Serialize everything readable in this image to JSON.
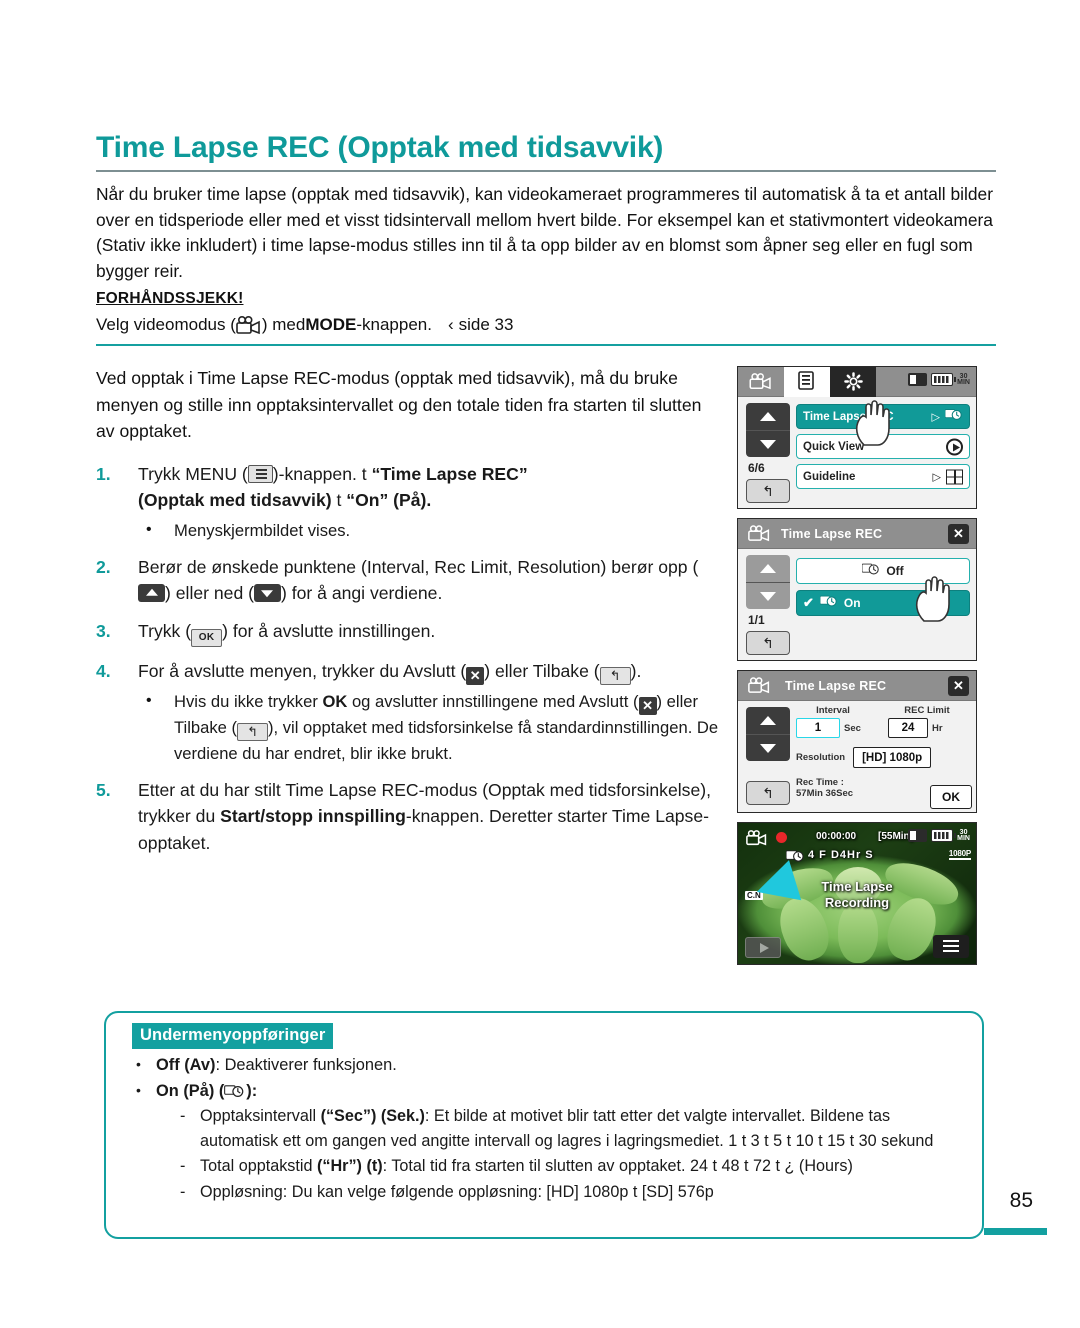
{
  "page": {
    "number": "85",
    "title": "Time Lapse REC (Opptak med tidsavvik)"
  },
  "intro": "Når du bruker time lapse (opptak med tidsavvik), kan videokameraet programmeres til automatisk å ta et antall bilder over en tidsperiode eller med et visst tidsintervall mellom hvert bilde. For eksempel kan et stativmontert videokamera (Stativ ikke inkludert) i time lapse-modus stilles inn til å ta opp bilder av en blomst som åpner seg eller en fugl som bygger reir.",
  "precheck": {
    "heading": "FORHÅNDSSJEKK!",
    "text_before": "Velg videomodus (",
    "camera_icon": "camcorder-icon",
    "text_mid": ") med ",
    "mode_bold": "MODE",
    "text_after": "-knappen.",
    "page_ref_arrow": "‹",
    "page_ref": "side 33"
  },
  "body": {
    "lead": "Ved opptak i Time Lapse REC-modus (opptak med tidsavvik), må du bruke menyen og stille inn opptaksintervallet og den totale tiden fra starten til slutten av opptaket.",
    "steps": [
      {
        "num": "1.",
        "t1": "Trykk MENU (",
        "icon1": "menu-icon",
        "t2": ")-knappen. ",
        "arrow1": "t",
        "b1": "“Time Lapse REC”",
        "b2": "(Opptak med tidsavvik)",
        "arrow2": "t",
        "b3": "“On” (På).",
        "sub": [
          "Menyskjermbildet vises."
        ]
      },
      {
        "num": "2.",
        "t1": "Berør de ønskede punktene (Interval, Rec Limit, Resolution) berør opp (",
        "icon_up": "arrow-up-icon",
        "t2": ") eller ned (",
        "icon_down": "arrow-down-icon",
        "t3": ") for å angi verdiene."
      },
      {
        "num": "3.",
        "t1": "Trykk (",
        "icon_ok": "ok-icon",
        "t2": ") for å avslutte innstillingen."
      },
      {
        "num": "4.",
        "t1": "For å avslutte menyen, trykker du Avslutt (",
        "icon_x": "close-icon",
        "t2": ") eller Tilbake (",
        "icon_back": "back-icon",
        "t3": ").",
        "sub_rich": {
          "p1": "Hvis du ikke trykker ",
          "ok": "OK",
          "p2": " og avslutter innstillingene med Avslutt (",
          "p3": ") eller Tilbake (",
          "p4": "), vil opptaket med tidsforsinkelse få standardinnstillingen. De verdiene du har endret, blir ikke brukt."
        }
      },
      {
        "num": "5.",
        "t1": "Etter at du har stilt Time Lapse REC-modus (Opptak med tidsforsinkelse), trykker du ",
        "b1": "Start/stopp innspilling",
        "t2": "-knappen. Deretter starter Time Lapse-opptaket."
      }
    ]
  },
  "lcd_screens": {
    "screen1": {
      "tab_video_icon": "camcorder-tab-icon",
      "tab_menu_icon": "menu-tab-icon",
      "tab_settings_icon": "gear-tab-icon",
      "status_sd": "sd-card-icon",
      "status_battery": "battery-icon",
      "status_min": "30 MIN",
      "up": "arrow-up-icon",
      "down": "arrow-down-icon",
      "page_indicator": "6/6",
      "back": "back-icon",
      "rows": [
        {
          "label": "Time Lapse REC",
          "selected": true,
          "arrow": "▷",
          "icon": "time-lapse-icon"
        },
        {
          "label": "Quick View",
          "selected": false,
          "arrow": "",
          "icon": "play-circle-icon"
        },
        {
          "label": "Guideline",
          "selected": false,
          "arrow": "▷",
          "icon": "guideline-icon"
        }
      ]
    },
    "screen2": {
      "header_icon": "camcorder-icon",
      "header_title": "Time Lapse REC",
      "close": "close-icon",
      "page_indicator": "1/1",
      "back": "back-icon",
      "options": [
        {
          "label": "Off",
          "selected": false,
          "check": "",
          "icon": "time-lapse-icon"
        },
        {
          "label": "On",
          "selected": true,
          "check": "✔",
          "icon": "time-lapse-icon"
        }
      ]
    },
    "screen3": {
      "header_icon": "camcorder-icon",
      "header_title": "Time Lapse REC",
      "close": "close-icon",
      "interval_label": "Interval",
      "interval_value": "1",
      "interval_unit": "Sec",
      "reclimit_label": "REC Limit",
      "reclimit_value": "24",
      "reclimit_unit": "Hr",
      "resolution_label": "Resolution",
      "resolution_value": "[HD] 1080p",
      "rectime_label": "Rec Time :",
      "rectime_value": "57Min 36Sec",
      "ok": "OK",
      "back": "back-icon"
    },
    "screen4": {
      "mode_icon": "camcorder-icon",
      "rec_dot": "record-indicator",
      "timecode": "00:00:00",
      "remaining": "[55Min]",
      "status_min": "30 MIN",
      "overlay_line2": "4 F  D4Hr  S",
      "quality_tag": "1080P",
      "cn_tag": "C.N",
      "center_line1": "Time Lapse",
      "center_line2": "Recording",
      "play_button": "play-icon",
      "menu_button": "menu-icon"
    }
  },
  "submenu": {
    "heading": "Undermenyoppføringer",
    "items": [
      {
        "bold": "Off (Av)",
        "rest": ": Deaktiverer funksjonen."
      },
      {
        "bold": "On (På)",
        "rest": " (",
        "icon": "time-lapse-icon",
        "tail": "):"
      }
    ],
    "details": [
      {
        "lead": "Opptaksintervall ",
        "bold": "(“Sec”) (Sek.)",
        "rest": ": Et bilde at motivet blir tatt etter det valgte intervallet. Bildene tas automatisk ett om gangen ved angitte intervall og lagres i lagringsmediet. 1  t  3  t  5  t  10  t  15  t  30 sekund"
      },
      {
        "lead": "Total opptakstid ",
        "bold": "(“Hr”) (t)",
        "rest": ": Total tid fra starten til slutten av opptaket. 24  t  48  t  72  t  ¿ (Hours)"
      },
      {
        "lead": "Oppløsning: Du kan velge følgende oppløsning:  [HD] 1080p  t  [SD] 576p",
        "bold": "",
        "rest": ""
      }
    ]
  },
  "colors": {
    "teal": "#13a0a0",
    "teal_dark": "#0d807e",
    "accent_cyan": "#25b0ad"
  }
}
